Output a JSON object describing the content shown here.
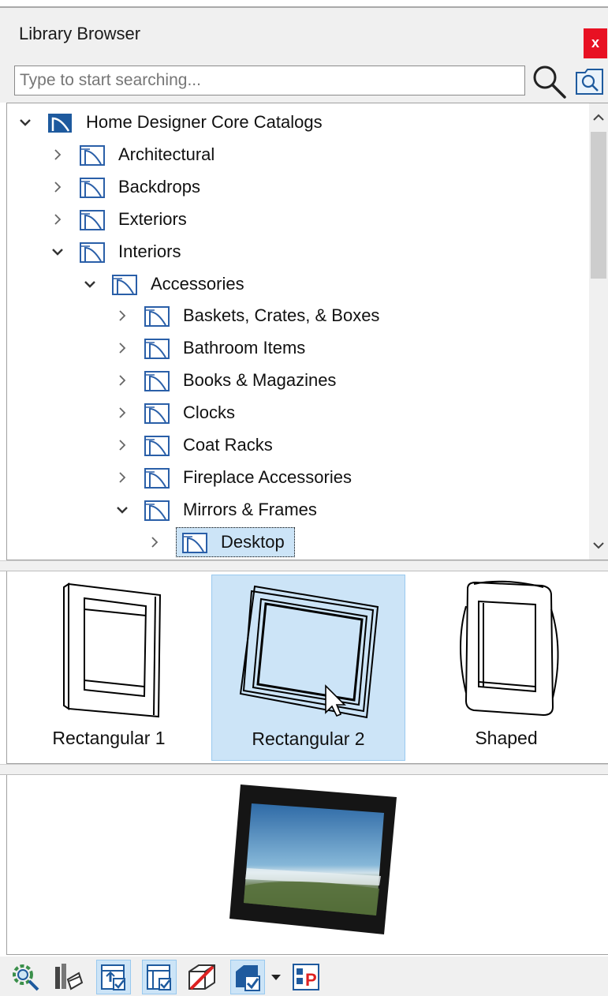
{
  "window": {
    "title": "Library Browser",
    "close_label": "x"
  },
  "search": {
    "placeholder": "Type to start searching...",
    "value": ""
  },
  "tree": {
    "items": [
      {
        "label": "Home Designer Core Catalogs",
        "level": 0,
        "expanded": true,
        "icon": "catalog-root-icon"
      },
      {
        "label": "Architectural",
        "level": 1,
        "expanded": false,
        "icon": "folder-icon"
      },
      {
        "label": "Backdrops",
        "level": 1,
        "expanded": false,
        "icon": "folder-icon"
      },
      {
        "label": "Exteriors",
        "level": 1,
        "expanded": false,
        "icon": "folder-icon"
      },
      {
        "label": "Interiors",
        "level": 1,
        "expanded": true,
        "icon": "folder-icon"
      },
      {
        "label": "Accessories",
        "level": 2,
        "expanded": true,
        "icon": "folder-icon"
      },
      {
        "label": "Baskets, Crates, & Boxes",
        "level": 3,
        "expanded": false,
        "icon": "folder-icon"
      },
      {
        "label": "Bathroom Items",
        "level": 3,
        "expanded": false,
        "icon": "folder-icon"
      },
      {
        "label": "Books & Magazines",
        "level": 3,
        "expanded": false,
        "icon": "folder-icon"
      },
      {
        "label": "Clocks",
        "level": 3,
        "expanded": false,
        "icon": "folder-icon"
      },
      {
        "label": "Coat Racks",
        "level": 3,
        "expanded": false,
        "icon": "folder-icon"
      },
      {
        "label": "Fireplace Accessories",
        "level": 3,
        "expanded": false,
        "icon": "folder-icon"
      },
      {
        "label": "Mirrors & Frames",
        "level": 3,
        "expanded": true,
        "icon": "folder-icon"
      },
      {
        "label": "Desktop",
        "level": 4,
        "expanded": false,
        "selected": true,
        "icon": "folder-icon"
      }
    ]
  },
  "thumbnails": [
    {
      "label": "Rectangular 1",
      "selected": false,
      "icon": "rectangular-frame-icon"
    },
    {
      "label": "Rectangular 2",
      "selected": true,
      "icon": "tilted-frame-icon"
    },
    {
      "label": "Shaped",
      "selected": false,
      "icon": "shaped-frame-icon"
    }
  ],
  "toolbar": {
    "buttons": [
      {
        "icon": "zoom-search-icon",
        "active": false
      },
      {
        "icon": "material-paint-icon",
        "active": false
      },
      {
        "icon": "add-to-plan-icon",
        "active": true
      },
      {
        "icon": "place-object-icon",
        "active": true
      },
      {
        "icon": "no-symbol-icon",
        "active": false
      },
      {
        "icon": "object-check-icon",
        "active": true
      },
      {
        "icon": "dropdown-arrow-icon",
        "active": false
      },
      {
        "icon": "properties-icon",
        "active": false
      }
    ]
  },
  "colors": {
    "selection": "#cce4f7",
    "close": "#e81123",
    "folder": "#1e5a9e"
  }
}
